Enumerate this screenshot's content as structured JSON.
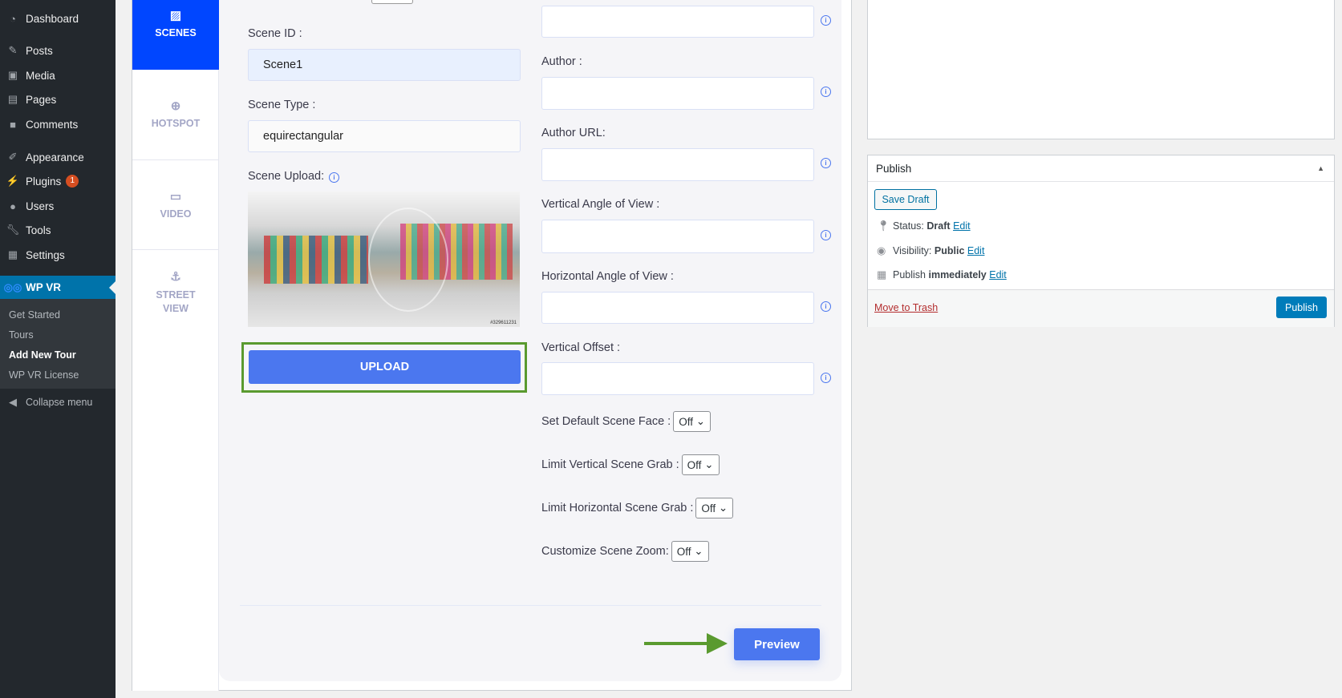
{
  "sidebar": {
    "items": [
      {
        "label": "Dashboard",
        "icon": "dashboard-icon"
      },
      {
        "label": "Posts",
        "icon": "pin-icon"
      },
      {
        "label": "Media",
        "icon": "media-icon"
      },
      {
        "label": "Pages",
        "icon": "pages-icon"
      },
      {
        "label": "Comments",
        "icon": "comment-icon"
      },
      {
        "label": "Appearance",
        "icon": "brush-icon"
      },
      {
        "label": "Plugins",
        "icon": "plugin-icon",
        "badge": "1"
      },
      {
        "label": "Users",
        "icon": "user-icon"
      },
      {
        "label": "Tools",
        "icon": "wrench-icon"
      },
      {
        "label": "Settings",
        "icon": "settings-icon"
      }
    ],
    "active": {
      "label": "WP VR",
      "icon": "vr-icon"
    },
    "submenu": [
      "Get Started",
      "Tours",
      "Add New Tour",
      "WP VR License"
    ],
    "collapse": "Collapse menu"
  },
  "tabs": [
    {
      "label": "SCENES"
    },
    {
      "label": "HOTSPOT"
    },
    {
      "label": "VIDEO"
    },
    {
      "label": "STREET VIEW"
    }
  ],
  "scene": {
    "id_label": "Scene ID :",
    "id_value": "Scene1",
    "type_label": "Scene Type :",
    "type_value": "equirectangular",
    "upload_label": "Scene Upload:",
    "upload_button": "UPLOAD",
    "image_caption": "#329611231"
  },
  "fields": [
    {
      "label": ""
    },
    {
      "label": "Author :"
    },
    {
      "label": "Author URL:"
    },
    {
      "label": "Vertical Angle of View :"
    },
    {
      "label": "Horizontal Angle of View :"
    },
    {
      "label": "Vertical Offset :"
    }
  ],
  "selects": [
    {
      "label": "Set Default Scene Face :",
      "value": "Off"
    },
    {
      "label": "Limit Vertical Scene Grab :",
      "value": "Off"
    },
    {
      "label": "Limit Horizontal Scene Grab :",
      "value": "Off"
    },
    {
      "label": "Customize Scene Zoom:",
      "value": "Off"
    }
  ],
  "preview_button": "Preview",
  "publish": {
    "title": "Publish",
    "save_draft": "Save Draft",
    "status_label": "Status:",
    "status_value": "Draft",
    "visibility_label": "Visibility:",
    "visibility_value": "Public",
    "publish_label": "Publish",
    "publish_value": "immediately",
    "edit": "Edit",
    "trash": "Move to Trash",
    "publish_button": "Publish"
  },
  "colors": {
    "accent": "#4b77ef",
    "active_tab": "#0046ff",
    "wp_blue": "#0073aa",
    "highlight": "#5a9a2f"
  }
}
